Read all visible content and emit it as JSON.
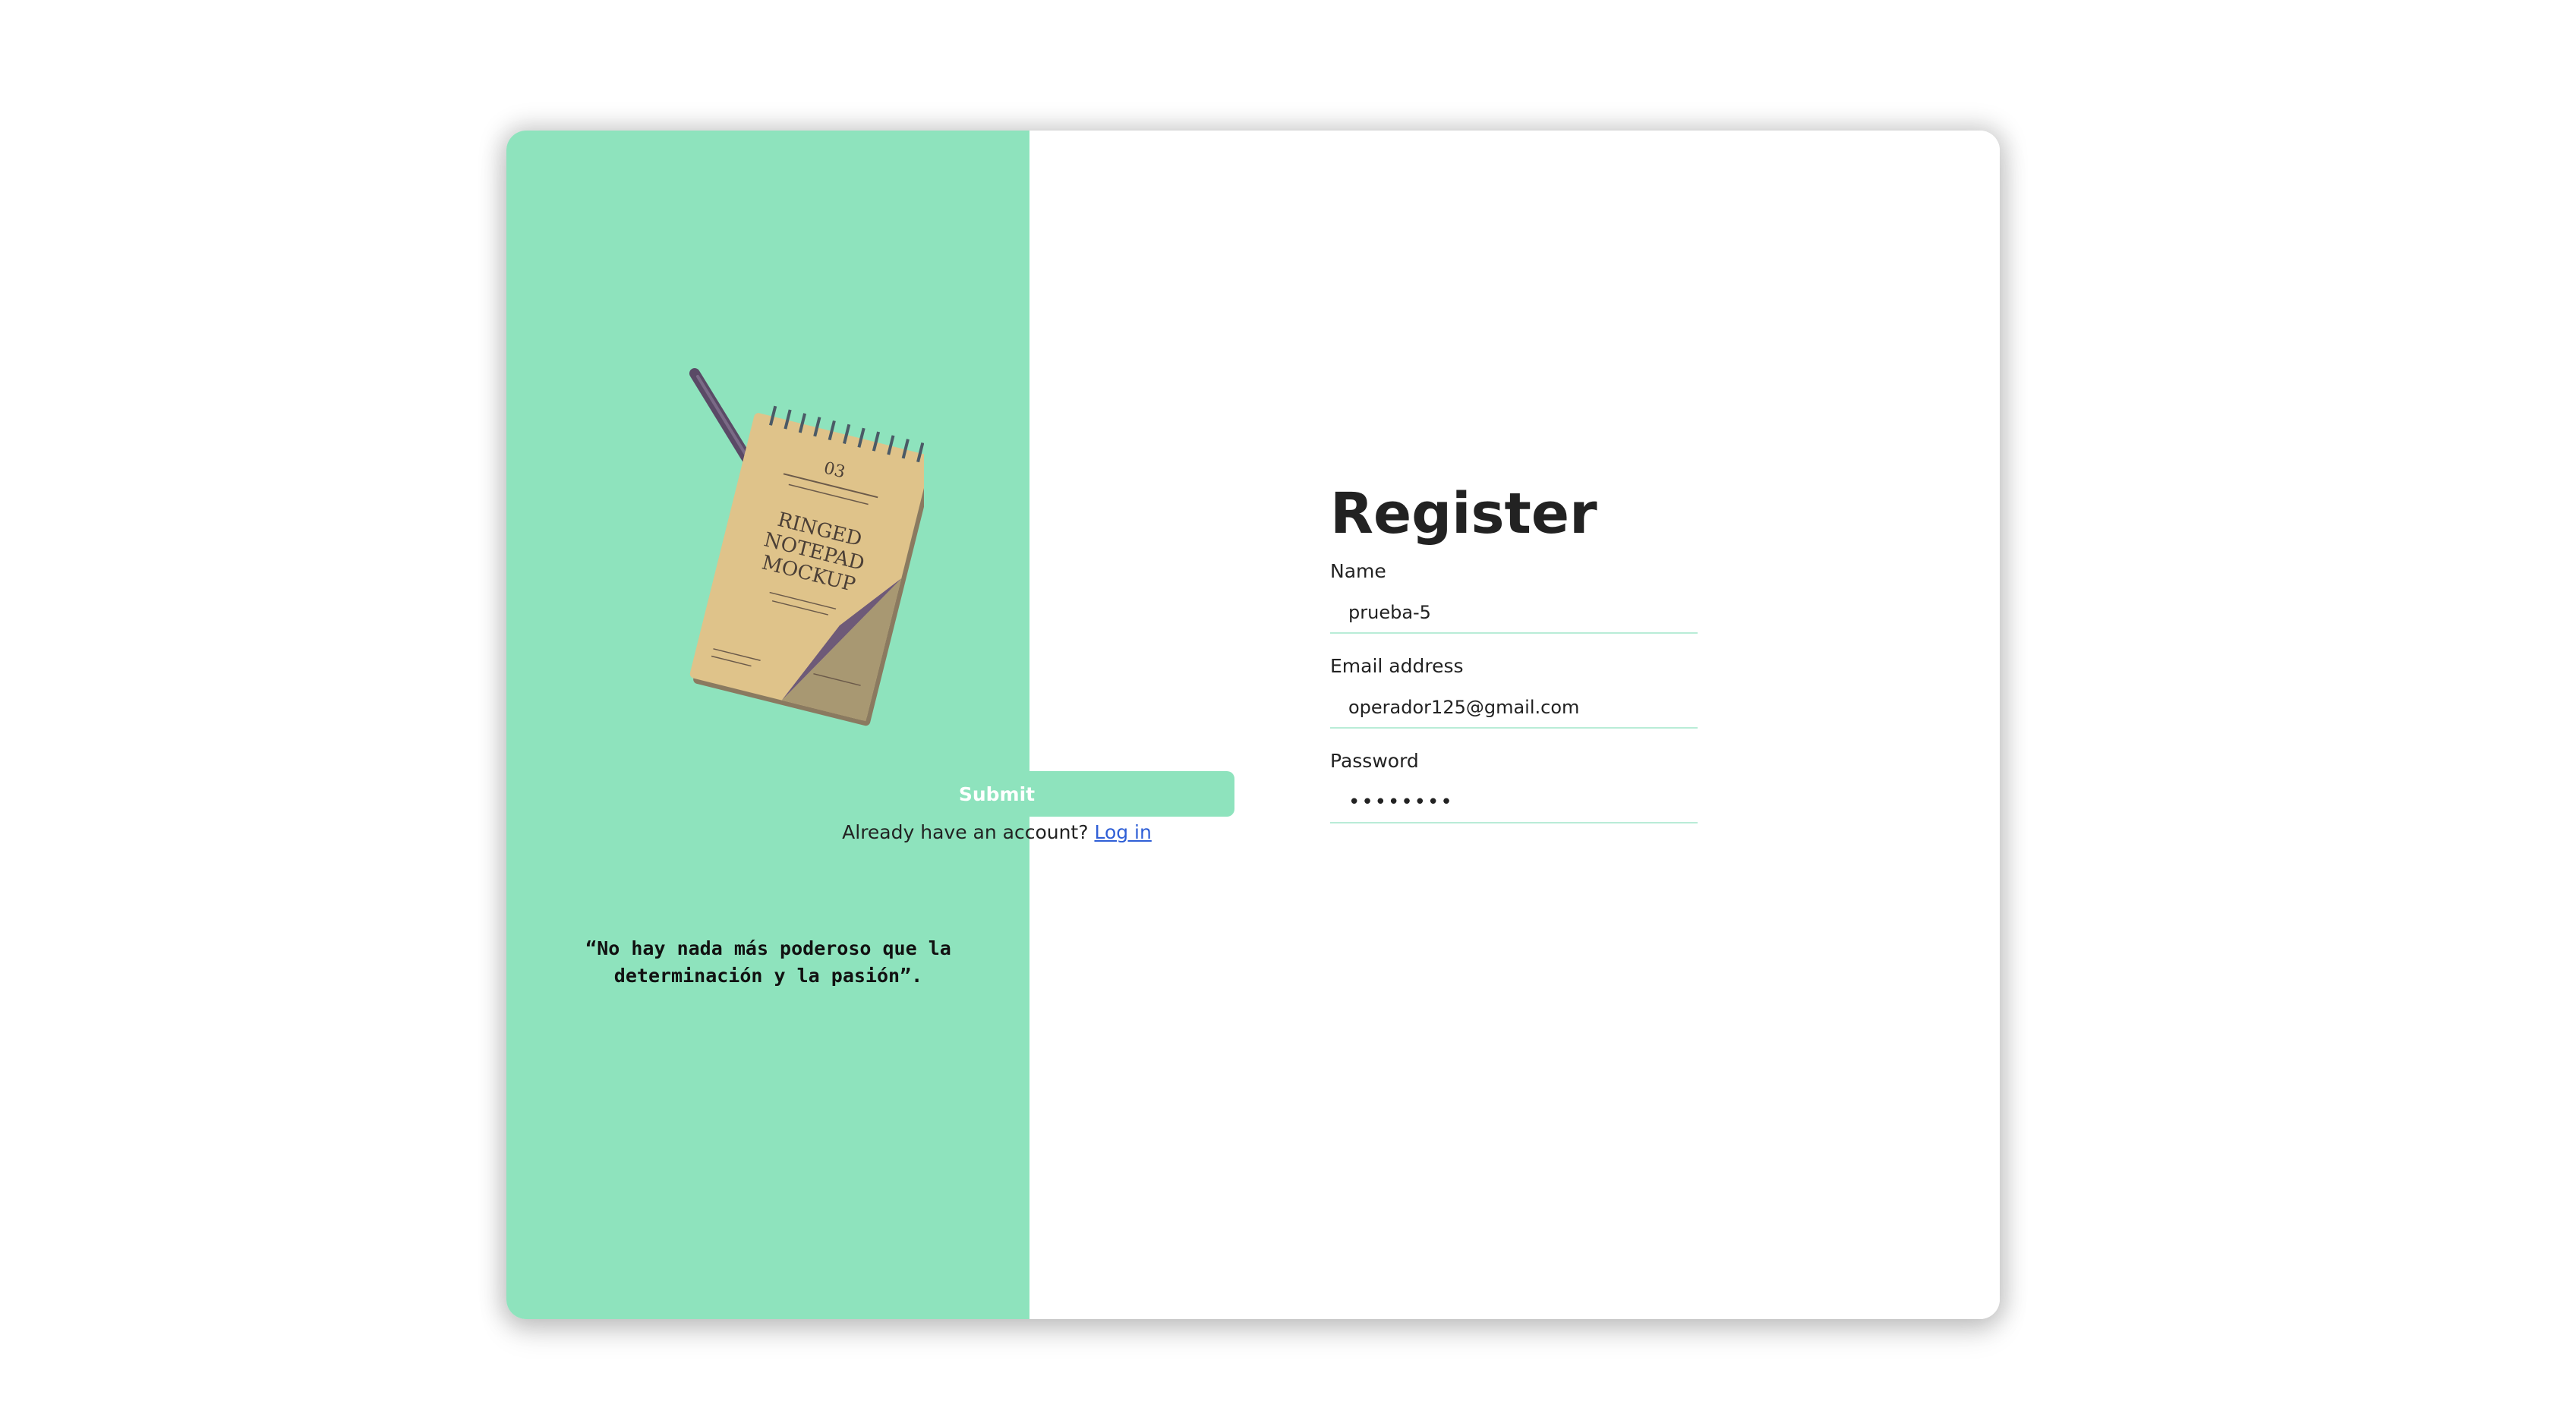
{
  "quote": "“No hay nada más poderoso que la determinación y la pasión”.",
  "illustration": {
    "notepad_text": [
      "RINGED",
      "NOTEPAD",
      "MOCKUP"
    ],
    "notepad_number": "03"
  },
  "form": {
    "title": "Register",
    "name": {
      "label": "Name",
      "value": "prueba-5"
    },
    "email": {
      "label": "Email address",
      "value": "operador125@gmail.com"
    },
    "password": {
      "label": "Password",
      "value": "••••••••"
    },
    "submit_label": "Submit",
    "login_prompt": "Already have an account?",
    "login_link": "Log in"
  },
  "colors": {
    "accent": "#8ee3bd",
    "link": "#2f5fd6"
  }
}
